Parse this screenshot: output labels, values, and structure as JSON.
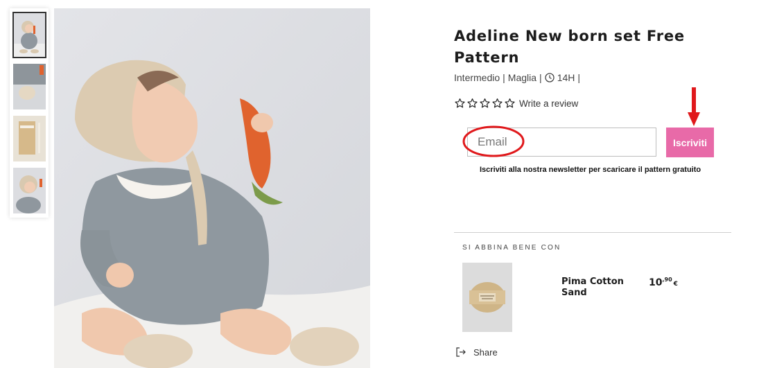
{
  "product": {
    "title": "Adeline New born set Free Pattern",
    "level": "Intermedio",
    "craft": "Maglia",
    "time": "14H",
    "separator": "|",
    "rating_stars": 0,
    "write_review": "Write a review"
  },
  "newsletter": {
    "placeholder": "Email",
    "button": "Iscriviti",
    "note": "Iscriviti alla nostra newsletter per scaricare il pattern gratuito"
  },
  "pairs": {
    "heading": "SI ABBINA BENE CON",
    "item": {
      "name": "Pima Cotton Sand",
      "price_int": "10",
      "price_dec": ",90",
      "currency": "€"
    }
  },
  "share": {
    "label": "Share"
  },
  "gallery": {
    "thumbnail_count": 4,
    "selected": 0
  },
  "colors": {
    "subscribe": "#e86aa8",
    "annotation": "#e0191c"
  }
}
